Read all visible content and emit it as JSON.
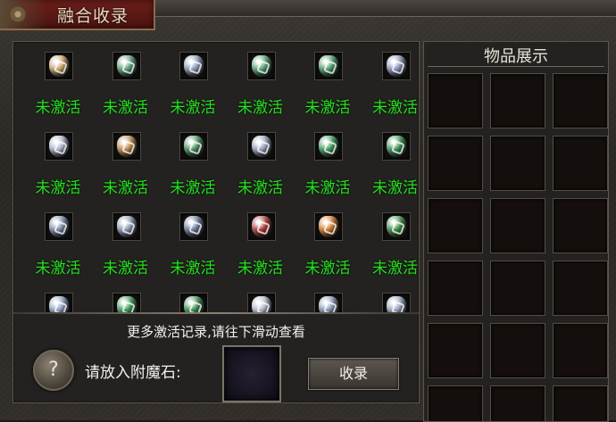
{
  "window": {
    "title": "融合收录"
  },
  "gems": [
    {
      "label": "未激活",
      "color": "#c9a46a"
    },
    {
      "label": "未激活",
      "color": "#5fa07a"
    },
    {
      "label": "未激活",
      "color": "#8a9bb4"
    },
    {
      "label": "未激活",
      "color": "#57a373"
    },
    {
      "label": "未激活",
      "color": "#4e9c6e"
    },
    {
      "label": "未激活",
      "color": "#8d94b8"
    },
    {
      "label": "未激活",
      "color": "#a9b4c8"
    },
    {
      "label": "未激活",
      "color": "#c08a4e"
    },
    {
      "label": "未激活",
      "color": "#4a9060"
    },
    {
      "label": "未激活",
      "color": "#98a2ba"
    },
    {
      "label": "未激活",
      "color": "#3f9a5c"
    },
    {
      "label": "未激活",
      "color": "#3e9058"
    },
    {
      "label": "未激活",
      "color": "#7c8aa6"
    },
    {
      "label": "未激活",
      "color": "#8f99b6"
    },
    {
      "label": "未激活",
      "color": "#6b7a9a"
    },
    {
      "label": "未激活",
      "color": "#b03a3a"
    },
    {
      "label": "未激活",
      "color": "#d07a2e"
    },
    {
      "label": "未激活",
      "color": "#3f8f47"
    },
    {
      "label": "",
      "color": "#8e9fbc"
    },
    {
      "label": "",
      "color": "#3f9a57"
    },
    {
      "label": "",
      "color": "#3a8d4f"
    },
    {
      "label": "",
      "color": "#aeb8c9"
    },
    {
      "label": "",
      "color": "#8798b5"
    },
    {
      "label": "",
      "color": "#9aa4bd"
    }
  ],
  "bottom": {
    "notice": "更多激活记录,请往下滑动查看",
    "help_symbol": "?",
    "place_label": "请放入附魔石:",
    "collect_button": "收录"
  },
  "display": {
    "title": "物品展示"
  }
}
